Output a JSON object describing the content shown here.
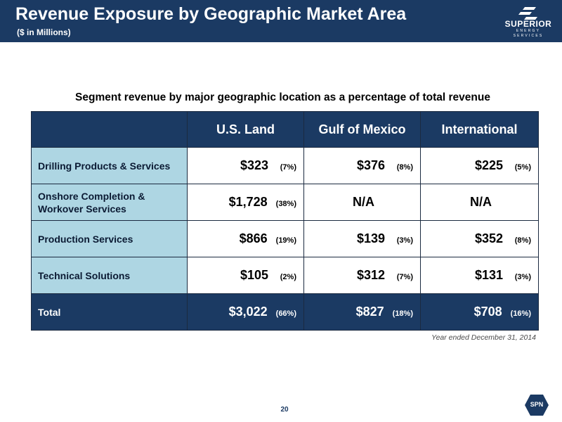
{
  "header": {
    "title": "Revenue Exposure by Geographic Market Area",
    "subtitle": "($ in Millions)",
    "logo_name": "SUPERIOR",
    "logo_tagline": "ENERGY SERVICES"
  },
  "table": {
    "caption": "Segment revenue by major geographic location as a percentage of total revenue",
    "columns": [
      "",
      "U.S. Land",
      "Gulf of Mexico",
      "International"
    ],
    "rows": [
      {
        "label": "Drilling Products & Services",
        "cells": [
          {
            "amount": "$323",
            "pct": "(7%)"
          },
          {
            "amount": "$376",
            "pct": "(8%)"
          },
          {
            "amount": "$225",
            "pct": "(5%)"
          }
        ]
      },
      {
        "label": "Onshore Completion & Workover Services",
        "cells": [
          {
            "amount": "$1,728",
            "pct": "(38%)"
          },
          {
            "amount": "N/A",
            "pct": ""
          },
          {
            "amount": "N/A",
            "pct": ""
          }
        ]
      },
      {
        "label": "Production Services",
        "cells": [
          {
            "amount": "$866",
            "pct": "(19%)"
          },
          {
            "amount": "$139",
            "pct": "(3%)"
          },
          {
            "amount": "$352",
            "pct": "(8%)"
          }
        ]
      },
      {
        "label": "Technical Solutions",
        "cells": [
          {
            "amount": "$105",
            "pct": "(2%)"
          },
          {
            "amount": "$312",
            "pct": "(7%)"
          },
          {
            "amount": "$131",
            "pct": "(3%)"
          }
        ]
      }
    ],
    "total": {
      "label": "Total",
      "cells": [
        {
          "amount": "$3,022",
          "pct": "(66%)"
        },
        {
          "amount": "$827",
          "pct": "(18%)"
        },
        {
          "amount": "$708",
          "pct": "(16%)"
        }
      ]
    }
  },
  "footnote": "Year ended December 31, 2014",
  "page_number": "20",
  "badge": "SPN",
  "colors": {
    "header_bg": "#1b3a63",
    "row_label_bg": "#aed6e3",
    "text": "#000000"
  }
}
